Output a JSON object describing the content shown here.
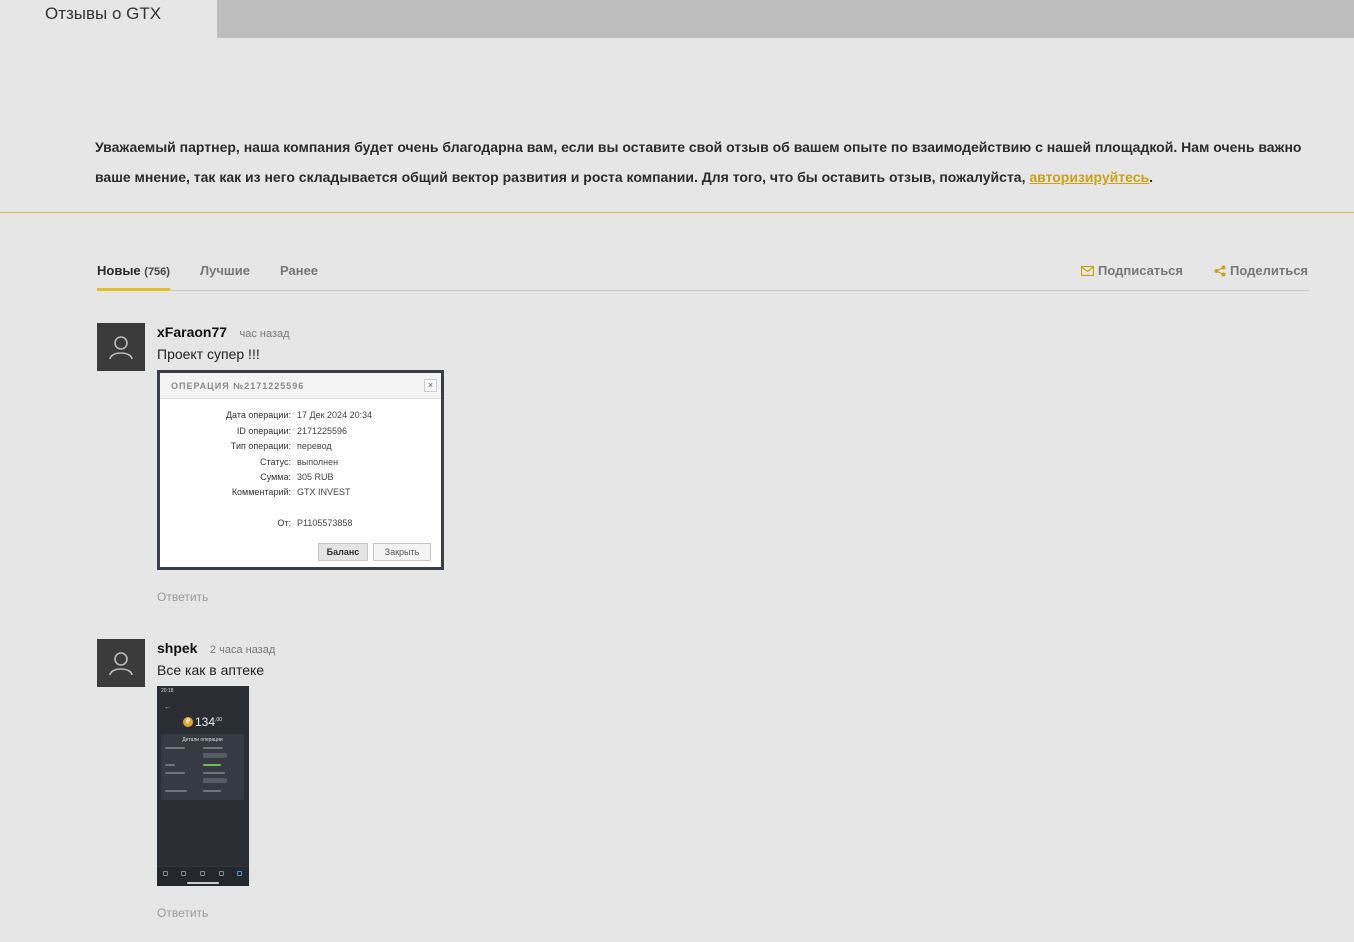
{
  "header": {
    "active_tab": "Отзывы о GTX"
  },
  "intro": {
    "text": "Уважаемый партнер, наша компания будет очень благодарна вам, если вы оставите свой отзыв об вашем опыте по взаимодействию с нашей площадкой. Нам очень важно ваше мнение, так как из него складывается общий вектор развития и роста компании. Для того, что бы оставить отзыв, пожалуйста, ",
    "link": "авторизируйтесь",
    "end": "."
  },
  "tabs": {
    "new_label": "Новые",
    "new_count": "(756)",
    "best_label": "Лучшие",
    "old_label": "Ранее",
    "subscribe_label": "Подписаться",
    "share_label": "Поделиться"
  },
  "colors": {
    "accent": "#e2bd25",
    "link": "#c9a21a"
  },
  "comments": [
    {
      "author": "xFaraon77",
      "time": "час назад",
      "text": "Проект супер !!!",
      "reply": "Ответить",
      "attachment": {
        "title": "ОПЕРАЦИЯ №2171225596",
        "close": "×",
        "rows": [
          {
            "k": "Дата операции:",
            "v": "17 Дек 2024 20:34"
          },
          {
            "k": "ID операции:",
            "v": "2171225596"
          },
          {
            "k": "Тип операции:",
            "v": "перевод"
          },
          {
            "k": "Статус:",
            "v": "выполнен"
          },
          {
            "k": "Сумма:",
            "v": "305 RUB"
          },
          {
            "k": "Комментарий:",
            "v": "GTX INVEST"
          },
          {
            "k": "От:",
            "v": "P1105573858"
          }
        ],
        "btn_balance": "Баланс",
        "btn_close": "Закрыть"
      }
    },
    {
      "author": "shpek",
      "time": "2 часа назад",
      "text": "Все как в аптеке",
      "reply": "Ответить",
      "attachment": {
        "status_time": "20:18",
        "back": "←",
        "coin": "₽",
        "amount": "134",
        "amount_cents": ",00",
        "card_title": "Детали операции"
      }
    }
  ]
}
